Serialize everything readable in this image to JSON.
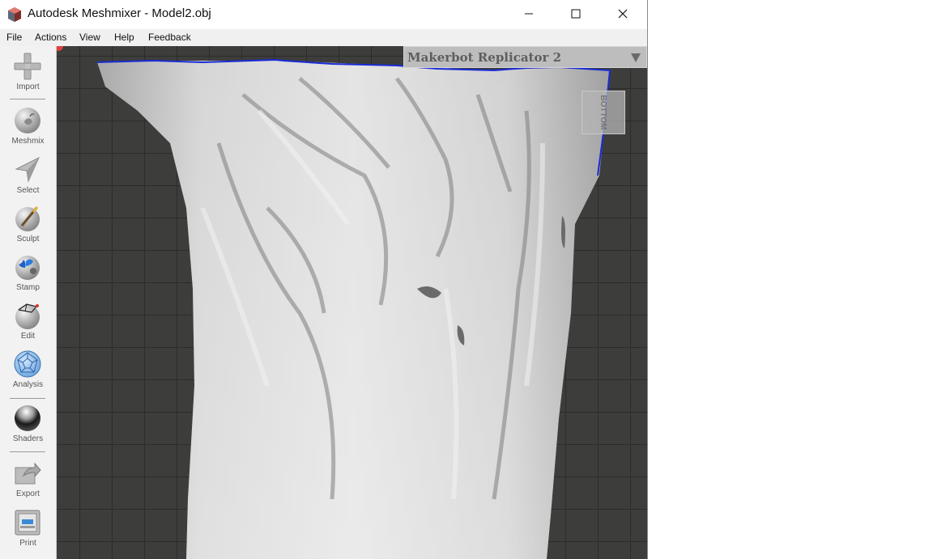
{
  "window": {
    "title": "Autodesk Meshmixer - Model2.obj",
    "minimize_label": "—",
    "maximize_label": "☐",
    "close_label": "✕"
  },
  "menu": {
    "items": [
      "File",
      "Actions",
      "View",
      "Help",
      "Feedback"
    ]
  },
  "toolbar": {
    "tools": [
      {
        "label": "Import",
        "icon": "plus-icon"
      },
      {
        "label": "Meshmix",
        "icon": "bunny-sphere-icon"
      },
      {
        "label": "Select",
        "icon": "arrow-cursor-icon"
      },
      {
        "label": "Sculpt",
        "icon": "brush-sphere-icon"
      },
      {
        "label": "Stamp",
        "icon": "stamp-sphere-icon"
      },
      {
        "label": "Edit",
        "icon": "edit-sphere-icon"
      },
      {
        "label": "Analysis",
        "icon": "geodesic-sphere-icon"
      },
      {
        "label": "Shaders",
        "icon": "chrome-sphere-icon"
      },
      {
        "label": "Export",
        "icon": "export-icon"
      },
      {
        "label": "Print",
        "icon": "printer-icon"
      }
    ]
  },
  "viewport": {
    "printer": "Makerbot Replicator 2",
    "viewcube_face": "BOTTOM",
    "mesh_color": "#d9d9d9",
    "boundary_color": "#1a2bd6",
    "grid_color": "#2c2c2b",
    "background_color": "#3d3d3c"
  }
}
